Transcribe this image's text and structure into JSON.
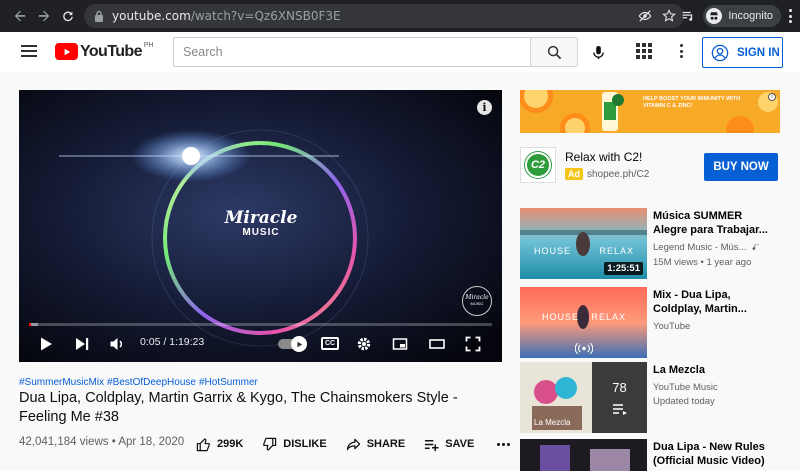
{
  "browser": {
    "url_host": "youtube.com",
    "url_path": "/watch?v=Qz6XNSB0F3E",
    "profile_label": "Incognito"
  },
  "header": {
    "logo_text": "YouTube",
    "country_code": "PH",
    "search_placeholder": "Search",
    "sign_in_label": "SIGN IN"
  },
  "player": {
    "overlay_title": "Miracle",
    "overlay_subtitle": "MUSIC",
    "watermark_line1": "Miracle",
    "watermark_line2": "MUSIC",
    "time_display": "0:05 / 1:19:23",
    "cc_label": "CC",
    "progress_played": 0.001,
    "progress_loaded": 0.02
  },
  "video": {
    "hashtags": [
      "#SummerMusicMix",
      "#BestOfDeepHouse",
      "#HotSummer"
    ],
    "title": "Dua Lipa, Coldplay, Martin Garrix & Kygo, The Chainsmokers Style - Feeling Me #38",
    "views": "42,041,184 views",
    "date": "Apr 18, 2020",
    "meta_separator": "•",
    "likes": "299K",
    "dislike_label": "DISLIKE",
    "share_label": "SHARE",
    "save_label": "SAVE"
  },
  "ad": {
    "banner_text": "HELP BOOST YOUR IMMUNITY WITH VITAMIN C & ZINC!",
    "logo_text": "C2",
    "title": "Relax with C2!",
    "badge": "Ad",
    "domain": "shopee.ph/C2",
    "cta": "BUY NOW"
  },
  "recommendations": [
    {
      "title": "Música SUMMER Alegre para Trabajar...",
      "channel": "Legend Music - Mús...",
      "stats": "15M views • 1 year ago",
      "duration": "1:25:51",
      "thumb_left": "HOUSE",
      "thumb_right": "RELAX"
    },
    {
      "title": "Mix - Dua Lipa, Coldplay, Martin...",
      "channel": "YouTube",
      "stats": "",
      "duration": "",
      "thumb_left": "HOUSE",
      "thumb_right": "RELAX"
    },
    {
      "title": "La Mezcla",
      "channel": "YouTube Music",
      "stats": "Updated today",
      "duration": "",
      "playlist_count": "78",
      "thumb_caption": "La Mezcla"
    },
    {
      "title": "Dua Lipa - New Rules (Official Music Video)",
      "channel": "",
      "stats": "",
      "duration": ""
    }
  ]
}
